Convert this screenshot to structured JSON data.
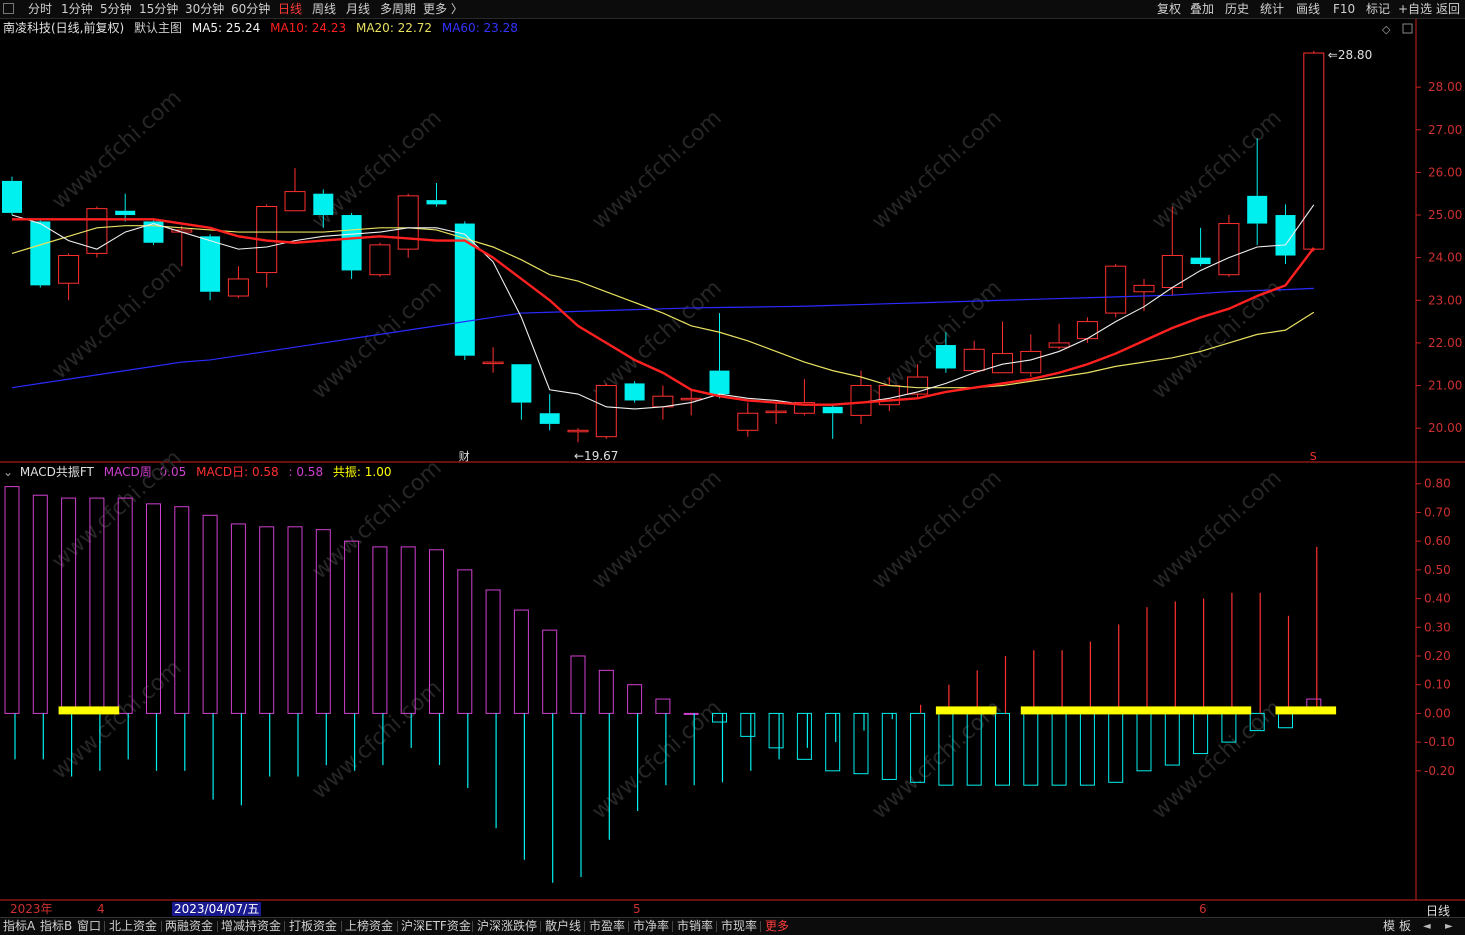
{
  "toolbar": {
    "periods": [
      "分时",
      "1分钟",
      "5分钟",
      "15分钟",
      "30分钟",
      "60分钟",
      "日线",
      "周线",
      "月线",
      "多周期",
      "更多 〉"
    ],
    "active_period": "日线",
    "right_tools": [
      "复权",
      "叠加",
      "历史",
      "统计",
      "画线",
      "F10",
      "标记",
      "+自选",
      "返回"
    ]
  },
  "main_chart": {
    "stock_title": "南凌科技(日线,前复权)",
    "template_name": "默认主图",
    "ma5": {
      "label": "MA5: 25.24",
      "color": "#f0f0f0"
    },
    "ma10": {
      "label": "MA10: 24.23",
      "color": "#ff2020"
    },
    "ma20": {
      "label": "MA20: 22.72",
      "color": "#e8e060"
    },
    "ma60": {
      "label": "MA60: 23.28",
      "color": "#2a2aff"
    },
    "high_label": "28.80",
    "low_label": "19.67",
    "fin_marker": "财",
    "s_marker": "S"
  },
  "macd_panel": {
    "title": "MACD共振FT",
    "week_label": "MACD周: 0.05",
    "day_label": "MACD日: 0.58",
    "unnamed_label": ": 0.58",
    "resonance_label": "共振: 1.00"
  },
  "colors": {
    "up": "#ff3030",
    "down": "#00f0f0",
    "macd_week": "#d040d0",
    "resonance": "#ffff00",
    "axis": "#cc2020"
  },
  "date_axis": {
    "year": "2023年",
    "m4": "4",
    "current_date": "2023/04/07/五",
    "m5": "5",
    "m6": "6",
    "period": "日线"
  },
  "bottom_tabs": [
    "指标A",
    "指标B",
    "窗口",
    "北上资金",
    "两融资金",
    "增减持资金",
    "打板资金",
    "上榜资金",
    "沪深ETF资金",
    "沪深涨跌停",
    "散户线",
    "市盈率",
    "市净率",
    "市销率",
    "市现率",
    "更多"
  ],
  "bottom_right": [
    "模",
    "板"
  ],
  "chart_data": [
    {
      "type": "candlestick",
      "y_ticks": [
        20.0,
        21.0,
        22.0,
        23.0,
        24.0,
        25.0,
        26.0,
        27.0,
        28.0
      ],
      "ylim": [
        19.3,
        29.2
      ],
      "candles": [
        [
          25.8,
          25.05,
          25.9,
          25.0
        ],
        [
          24.85,
          23.35,
          24.9,
          23.3
        ],
        [
          23.4,
          24.05,
          24.1,
          23.0
        ],
        [
          24.1,
          25.15,
          25.2,
          24.0
        ],
        [
          25.1,
          25.0,
          25.5,
          24.85
        ],
        [
          24.85,
          24.35,
          24.9,
          24.3
        ],
        [
          24.6,
          24.65,
          24.75,
          23.8
        ],
        [
          24.5,
          23.2,
          24.55,
          23.0
        ],
        [
          23.1,
          23.5,
          23.8,
          23.05
        ],
        [
          23.65,
          25.2,
          25.25,
          23.3
        ],
        [
          25.1,
          25.55,
          26.1,
          25.1
        ],
        [
          25.5,
          25.0,
          25.6,
          24.7
        ],
        [
          25.0,
          23.7,
          25.05,
          23.5
        ],
        [
          23.6,
          24.3,
          24.35,
          23.55
        ],
        [
          24.2,
          25.45,
          25.5,
          24.0
        ],
        [
          25.35,
          25.25,
          25.75,
          25.2
        ],
        [
          24.8,
          21.7,
          24.85,
          21.6
        ],
        [
          21.55,
          21.55,
          21.9,
          21.3
        ],
        [
          21.5,
          20.6,
          21.5,
          20.2
        ],
        [
          20.35,
          20.1,
          20.8,
          19.95
        ],
        [
          19.95,
          19.95,
          20.0,
          19.67
        ],
        [
          19.8,
          21.0,
          21.05,
          19.75
        ],
        [
          21.05,
          20.65,
          21.1,
          20.6
        ],
        [
          20.5,
          20.75,
          21.0,
          20.2
        ],
        [
          20.7,
          20.7,
          20.9,
          20.3
        ],
        [
          21.35,
          20.8,
          22.7,
          20.7
        ],
        [
          19.95,
          20.35,
          20.6,
          19.8
        ],
        [
          20.4,
          20.4,
          20.6,
          20.1
        ],
        [
          20.35,
          20.6,
          21.15,
          20.3
        ],
        [
          20.5,
          20.35,
          20.55,
          19.75
        ],
        [
          20.3,
          21.0,
          21.35,
          20.1
        ],
        [
          20.55,
          21.0,
          21.2,
          20.4
        ],
        [
          20.8,
          21.2,
          21.5,
          20.7
        ],
        [
          21.95,
          21.4,
          22.25,
          21.3
        ],
        [
          21.35,
          21.85,
          22.05,
          21.3
        ],
        [
          21.3,
          21.75,
          22.5,
          21.3
        ],
        [
          21.3,
          21.8,
          22.2,
          21.2
        ],
        [
          21.9,
          22.0,
          22.45,
          21.85
        ],
        [
          22.1,
          22.5,
          22.6,
          22.0
        ],
        [
          22.7,
          23.8,
          23.85,
          22.6
        ],
        [
          23.2,
          23.35,
          23.5,
          22.75
        ],
        [
          23.3,
          24.05,
          25.2,
          23.1
        ],
        [
          24.0,
          23.85,
          24.7,
          23.8
        ],
        [
          23.6,
          24.8,
          25.0,
          23.55
        ],
        [
          25.45,
          24.8,
          26.8,
          24.3
        ],
        [
          25.0,
          24.05,
          25.25,
          23.85
        ],
        [
          24.2,
          28.8,
          28.85,
          24.15
        ]
      ],
      "ma5": [
        25.0,
        24.8,
        24.4,
        24.2,
        24.6,
        24.8,
        24.6,
        24.4,
        24.2,
        24.25,
        24.4,
        24.5,
        24.55,
        24.6,
        24.7,
        24.7,
        24.55,
        23.9,
        22.6,
        20.9,
        20.8,
        20.5,
        20.45,
        20.5,
        20.6,
        20.8,
        20.7,
        20.65,
        20.55,
        20.55,
        20.6,
        20.7,
        20.85,
        21.05,
        21.3,
        21.5,
        21.6,
        21.8,
        22.1,
        22.5,
        22.85,
        23.3,
        23.7,
        24.0,
        24.25,
        24.3,
        25.24
      ],
      "ma10": [
        24.9,
        24.9,
        24.9,
        24.9,
        24.9,
        24.9,
        24.8,
        24.7,
        24.5,
        24.4,
        24.35,
        24.4,
        24.45,
        24.5,
        24.45,
        24.4,
        24.4,
        24.0,
        23.5,
        23.0,
        22.4,
        22.0,
        21.6,
        21.3,
        20.9,
        20.75,
        20.65,
        20.6,
        20.55,
        20.55,
        20.6,
        20.65,
        20.7,
        20.85,
        20.95,
        21.05,
        21.15,
        21.3,
        21.5,
        21.75,
        22.05,
        22.35,
        22.6,
        22.8,
        23.1,
        23.35,
        24.23
      ],
      "ma20": [
        24.1,
        24.3,
        24.5,
        24.7,
        24.75,
        24.75,
        24.7,
        24.65,
        24.6,
        24.6,
        24.6,
        24.6,
        24.65,
        24.7,
        24.7,
        24.65,
        24.45,
        24.25,
        23.95,
        23.6,
        23.45,
        23.2,
        22.95,
        22.7,
        22.4,
        22.25,
        22.05,
        21.8,
        21.55,
        21.35,
        21.2,
        21.0,
        20.95,
        20.95,
        20.95,
        21.0,
        21.1,
        21.2,
        21.3,
        21.45,
        21.55,
        21.65,
        21.8,
        22.0,
        22.2,
        22.3,
        22.72
      ],
      "ma60": [
        20.95,
        21.05,
        21.15,
        21.25,
        21.35,
        21.45,
        21.55,
        21.6,
        21.7,
        21.8,
        21.9,
        22.0,
        22.1,
        22.2,
        22.3,
        22.4,
        22.5,
        22.6,
        22.7,
        22.72,
        22.74,
        22.76,
        22.78,
        22.8,
        22.82,
        22.83,
        22.84,
        22.85,
        22.86,
        22.88,
        22.9,
        22.92,
        22.94,
        22.96,
        22.98,
        23.0,
        23.02,
        23.04,
        23.06,
        23.08,
        23.1,
        23.12,
        23.16,
        23.2,
        23.23,
        23.25,
        23.28
      ]
    },
    {
      "type": "bar",
      "y_ticks": [
        -0.2,
        -0.1,
        0.0,
        0.1,
        0.2,
        0.3,
        0.4,
        0.5,
        0.6,
        0.7,
        0.8
      ],
      "ylim": [
        -0.65,
        0.82
      ],
      "macd_week": [
        0.79,
        0.76,
        0.75,
        0.75,
        0.75,
        0.73,
        0.72,
        0.69,
        0.66,
        0.65,
        0.65,
        0.64,
        0.6,
        0.58,
        0.58,
        0.57,
        0.5,
        0.43,
        0.36,
        0.29,
        0.2,
        0.15,
        0.1,
        0.05,
        0.0,
        -0.03,
        -0.08,
        -0.12,
        -0.16,
        -0.2,
        -0.21,
        -0.23,
        -0.24,
        -0.25,
        -0.25,
        -0.25,
        -0.25,
        -0.25,
        -0.25,
        -0.24,
        -0.2,
        -0.18,
        -0.14,
        -0.1,
        -0.06,
        -0.05,
        0.05
      ],
      "macd_day": [
        -0.16,
        -0.16,
        -0.22,
        -0.2,
        -0.16,
        -0.2,
        -0.2,
        -0.3,
        -0.32,
        -0.22,
        -0.22,
        -0.18,
        -0.2,
        -0.18,
        -0.12,
        -0.18,
        -0.26,
        -0.4,
        -0.51,
        -0.59,
        -0.57,
        -0.44,
        -0.34,
        -0.25,
        -0.25,
        -0.24,
        -0.2,
        -0.16,
        -0.12,
        -0.1,
        -0.06,
        -0.02,
        0.03,
        0.1,
        0.15,
        0.2,
        0.22,
        0.22,
        0.25,
        0.31,
        0.37,
        0.39,
        0.4,
        0.42,
        0.42,
        0.34,
        0.58
      ],
      "resonance_ranges": [
        [
          2,
          4
        ],
        [
          33,
          35
        ],
        [
          36,
          44
        ],
        [
          45,
          47
        ]
      ]
    }
  ]
}
